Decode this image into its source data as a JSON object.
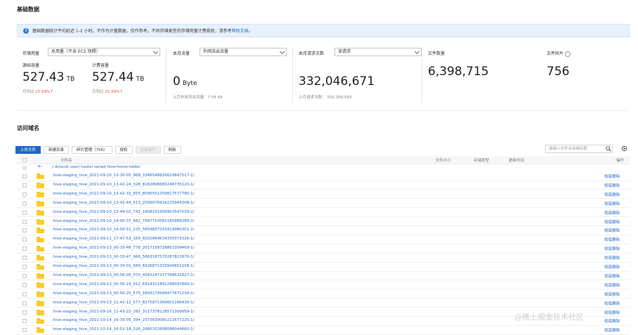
{
  "basic": {
    "title": "基础数据",
    "notice_text": "基础数据统计平均延迟 1-2 小时。不作为计量数据，仅作参考。不同存储类型的存储用量计费规则，请参考",
    "notice_link": "帮助文档",
    "notice_tail": "。",
    "storage_label": "存储用量",
    "storage_select": "总用量（不含 ECS 快照）",
    "raw_label": "源始容量",
    "raw_value": "527.43",
    "raw_unit": "TB",
    "raw_mom_label": "月同比",
    "raw_mom_value": "15.59%↑",
    "billed_label": "计费容量",
    "billed_value": "527.44",
    "billed_unit": "TB",
    "billed_mom_label": "月同比",
    "billed_mom_value": "15.59%↑",
    "traffic_label": "本月流量",
    "traffic_select": "外网流出流量",
    "traffic_value": "0",
    "traffic_unit": "Byte",
    "traffic_prev": "上月外网流出流量：7.58 KB",
    "requests_label": "本月请求次数",
    "requests_select": "读请求",
    "requests_value": "332,046,671",
    "requests_prev": "上月请求次数：  330,266,589",
    "files_label": "文件数量",
    "files_value": "6,398,715",
    "fragments_label": "文件碎片",
    "fragments_value": "756"
  },
  "access": {
    "title": "访问域名"
  },
  "toolbar": {
    "upload": "上传文件",
    "new_dir": "新建目录",
    "fragments": "碎片管理（756）",
    "auth": "授权",
    "batch": "批量操作",
    "refresh": "刷新",
    "search_placeholder": "请输入文件名前缀匹配"
  },
  "table": {
    "col_name": "文件名",
    "col_size": "文件大小",
    "col_type": "存储类型",
    "col_time": "更新时间",
    "col_op": "操作",
    "breadcrumb": "/  dcloud/  user/  hoste/  serial/  hive-home-table/",
    "op_label": "彻底删除",
    "rows": [
      ".hive-staging_hive_2021-09-10_13-30-05_968_3346548826629847517-1/",
      ".hive-staging_hive_2021-09-10_13-42-24_328_8162898680248735120-1/",
      ".hive-staging_hive_2021-09-10_13-42-33_855_8586551259817577780-1/",
      ".hive-staging_hive_2021-09-10_13-42-44_513_2056076916225944308-1/",
      ".hive-staging_hive_2021-09-10_13-49-02_742_1808161956903547039-2/",
      ".hive-staging_hive_2021-09-10_14-00-37_662_7997710581180988288-2/",
      ".hive-staging_hive_2021-09-10_14-00-51_235_5659837333419960301-2/",
      ".hive-staging_hive_2021-09-11_17-47-53_169_8202869634335073326-1/",
      ".hive-staging_hive_2021-09-13_00-33-46_778_2017158728863309469-1/",
      ".hive-staging_hive_2021-09-13_00-33-47_966_5663187570287822870-1/",
      ".hive-staging_hive_2021-09-13_00-34-01_689_6926871333940651158-1/",
      ".hive-staging_hive_2021-09-13_00-56-00_070_4042247277768632827-1/",
      ".hive-staging_hive_2021-09-13_00-56-19_012_6914311891298097840-1/",
      ".hive-staging_hive_2021-09-13_00-56-20_575_1656179568477871239-1/",
      ".hive-staging_hive_2021-09-13_11-42-12_577_8275871369601166439-1/",
      ".hive-staging_hive_2021-09-16_11-43-22_282_3117378128571309959-1/",
      ".hive-staging_hive_2021-10-14_16-39-05_394_2373630060211677225-1/",
      ".hive-staging_hive_2021-10-14_16-52-18_226_2680702608086044660-1/"
    ]
  },
  "watermark": "@稀土掘金技术社区"
}
